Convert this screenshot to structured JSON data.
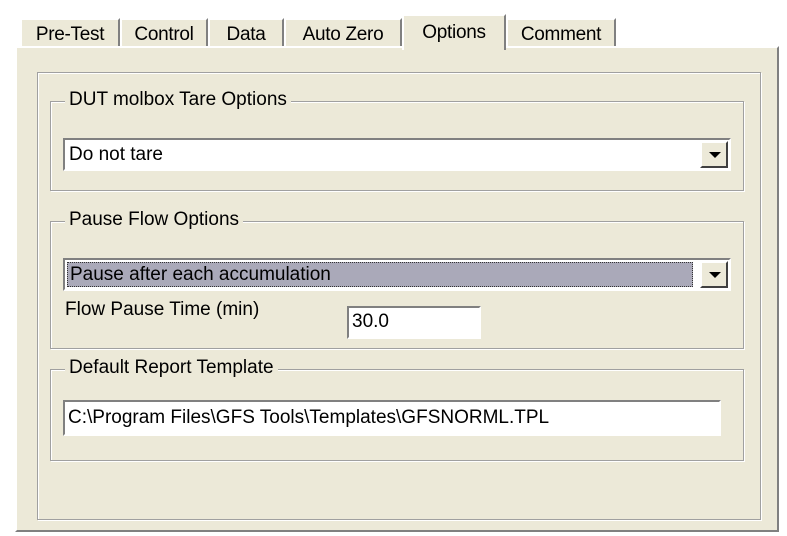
{
  "tabs": [
    {
      "label": "Pre-Test"
    },
    {
      "label": "Control"
    },
    {
      "label": "Data"
    },
    {
      "label": "Auto Zero"
    },
    {
      "label": "Options",
      "active": true
    },
    {
      "label": "Comment"
    }
  ],
  "tare_options": {
    "legend": "DUT molbox Tare Options",
    "selected": "Do not tare"
  },
  "pause_options": {
    "legend": "Pause Flow Options",
    "selected": "Pause after each accumulation",
    "pause_time_label": "Flow Pause Time (min)",
    "pause_time_value": "30.0"
  },
  "report_template": {
    "legend": "Default Report Template",
    "path": "C:\\Program Files\\GFS Tools\\Templates\\GFSNORML.TPL"
  },
  "colors": {
    "panel": "#ece9d8",
    "selection": "#aaa9b9"
  }
}
